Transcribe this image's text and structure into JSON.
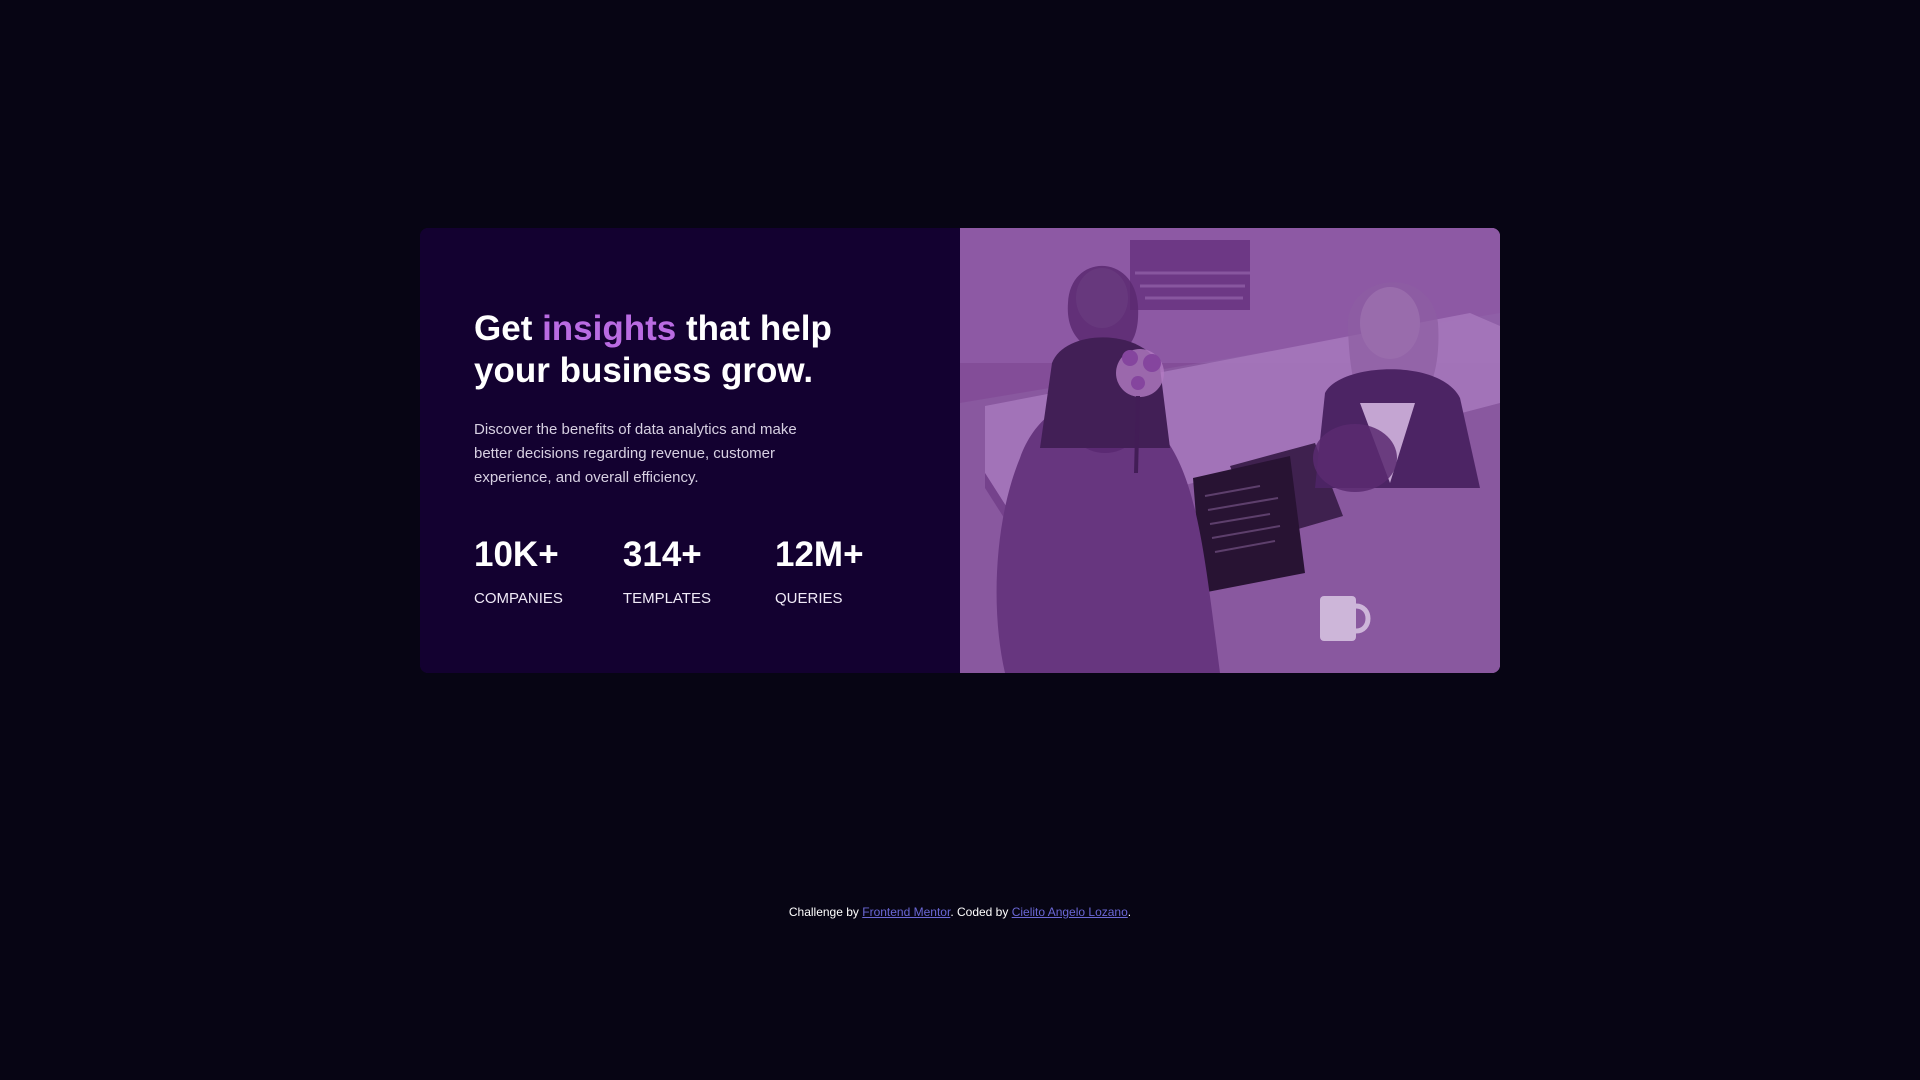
{
  "card": {
    "headline": {
      "before": "Get ",
      "accent": "insights",
      "after": " that help your business grow."
    },
    "description": "Discover the benefits of data analytics and make better decisions regarding revenue, customer experience, and overall efficiency.",
    "stats": [
      {
        "value": "10K+",
        "label": "COMPANIES"
      },
      {
        "value": "314+",
        "label": "TEMPLATES"
      },
      {
        "value": "12M+",
        "label": "QUERIES"
      }
    ]
  },
  "colors": {
    "page_background": "#070514",
    "card_background": "#130130",
    "accent": "#b96be2",
    "image_tint": "#8d579f",
    "link": "#6b68d6"
  },
  "footer": {
    "challenge_prefix": "Challenge by ",
    "challenge_link": "Frontend Mentor",
    "middle": ". Coded by ",
    "author_link": "Cielito Angelo Lozano",
    "suffix": "."
  }
}
